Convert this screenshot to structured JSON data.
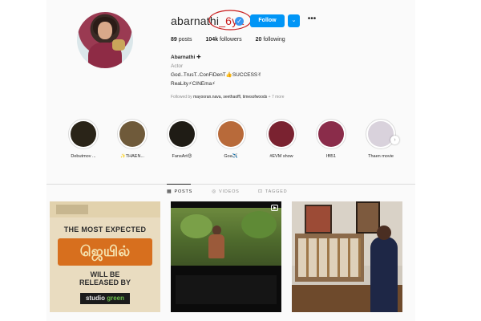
{
  "profile": {
    "username": "abarnathi",
    "username_scribble": "_6ya",
    "verified_glyph": "✓",
    "follow_label": "Follow",
    "dropdown_glyph": "⌄",
    "more_glyph": "•••"
  },
  "stats": {
    "posts_count": "89",
    "posts_label": "posts",
    "followers_count": "104k",
    "followers_label": "followers",
    "following_count": "20",
    "following_label": "following"
  },
  "bio": {
    "name": "Abarnathi ✚",
    "category": "Actor",
    "line1": "God..TrusT..ConFiDenT👍SUCCESS✌",
    "line2": "ReaLity⚡CINEma⚡",
    "followed_prefix": "Followed by ",
    "followed_names": "mayooran.nava, seethaoffl, timesofwoods",
    "followed_more": " + 7 more"
  },
  "highlights": [
    {
      "label": "Debutmov ...",
      "color": "#2a2418"
    },
    {
      "label": "✨THAEN...",
      "color": "#6f5a3a"
    },
    {
      "label": "FansArt😍",
      "color": "#1f1c15"
    },
    {
      "label": "Goa✈️",
      "color": "#b86a3a"
    },
    {
      "label": "#EVM show",
      "color": "#7a2230"
    },
    {
      "label": "IffI51",
      "color": "#8a2c4a"
    },
    {
      "label": "Thaen movie",
      "color": "#d9d2dc"
    }
  ],
  "highlight_next_glyph": "›",
  "tabs": {
    "posts": "POSTS",
    "videos": "VIDEOS",
    "tagged": "TAGGED"
  },
  "posts": {
    "post1": {
      "headline": "THE MOST EXPECTED",
      "title_tamil": "ஜெயில்",
      "line_will": "WILL BE",
      "line_released": "RELEASED BY",
      "studio_prefix": "studio ",
      "studio_suffix": "green"
    }
  },
  "colors": {
    "accent": "#0095f6",
    "verified": "#3897f0",
    "annotation": "#c91c1c"
  }
}
